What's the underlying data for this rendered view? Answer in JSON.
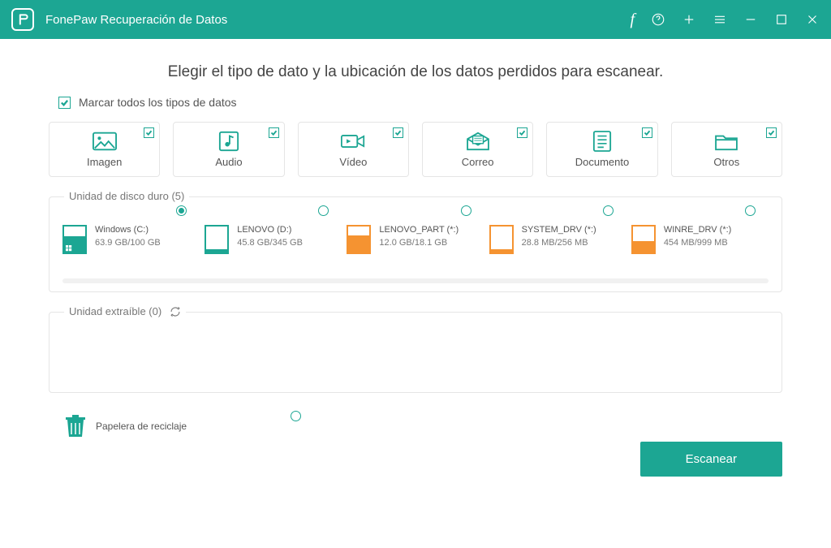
{
  "app_title": "FonePaw Recuperación de Datos",
  "heading": "Elegir el tipo de dato y la ubicación de los datos perdidos para escanear.",
  "check_all_label": "Marcar todos los tipos de datos",
  "data_types": {
    "imagen": "Imagen",
    "audio": "Audio",
    "video": "Vídeo",
    "correo": "Correo",
    "documento": "Documento",
    "otros": "Otros"
  },
  "hdd_section": {
    "title": "Unidad de disco duro (5)"
  },
  "drives": {
    "c": {
      "name": "Windows (C:)",
      "size": "63.9 GB/100 GB"
    },
    "d": {
      "name": "LENOVO (D:)",
      "size": "45.8 GB/345 GB"
    },
    "part": {
      "name": "LENOVO_PART (*:)",
      "size": "12.0 GB/18.1 GB"
    },
    "sys": {
      "name": "SYSTEM_DRV (*:)",
      "size": "28.8 MB/256 MB"
    },
    "winre": {
      "name": "WINRE_DRV (*:)",
      "size": "454 MB/999 MB"
    }
  },
  "removable_section": {
    "title": "Unidad extraíble (0)"
  },
  "recycle": {
    "label": "Papelera de reciclaje"
  },
  "scan_button": "Escanear"
}
